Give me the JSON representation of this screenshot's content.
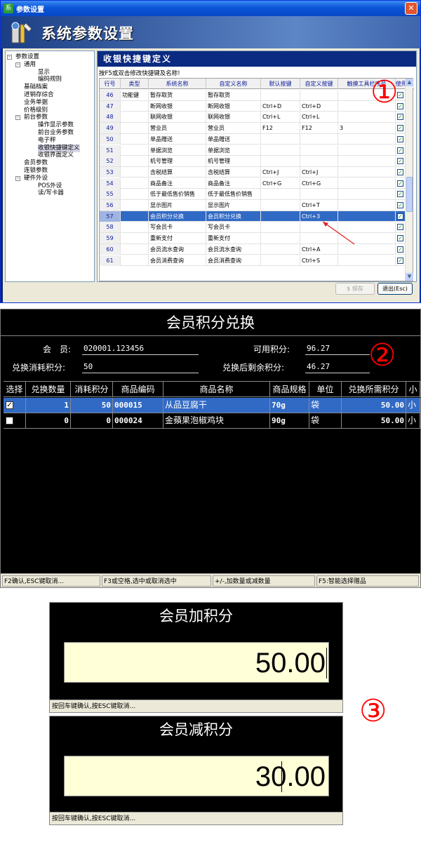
{
  "panel1": {
    "window_title": "参数设置",
    "app_icon": "系",
    "banner_title": "系统参数设置",
    "tree": [
      {
        "label": "参数设置",
        "level": 0,
        "expander": "-"
      },
      {
        "label": "通用",
        "level": 1,
        "expander": "-"
      },
      {
        "label": "显示",
        "level": 2,
        "expander": ""
      },
      {
        "label": "编码规则",
        "level": 2,
        "expander": ""
      },
      {
        "label": "基础档案",
        "level": 1,
        "expander": ""
      },
      {
        "label": "进销存综合",
        "level": 1,
        "expander": ""
      },
      {
        "label": "业务单据",
        "level": 1,
        "expander": ""
      },
      {
        "label": "价格级别",
        "level": 1,
        "expander": ""
      },
      {
        "label": "前台参数",
        "level": 1,
        "expander": "-"
      },
      {
        "label": "操作显示参数",
        "level": 2,
        "expander": ""
      },
      {
        "label": "前台业务参数",
        "level": 2,
        "expander": ""
      },
      {
        "label": "电子秤",
        "level": 2,
        "expander": ""
      },
      {
        "label": "收银快捷键定义",
        "level": 2,
        "expander": "",
        "selected": true
      },
      {
        "label": "收银界面定义",
        "level": 2,
        "expander": ""
      },
      {
        "label": "会员参数",
        "level": 1,
        "expander": ""
      },
      {
        "label": "连锁参数",
        "level": 1,
        "expander": ""
      },
      {
        "label": "硬件外设",
        "level": 1,
        "expander": "-"
      },
      {
        "label": "POS外设",
        "level": 2,
        "expander": ""
      },
      {
        "label": "读/写卡器",
        "level": 2,
        "expander": ""
      }
    ],
    "section_title": "收银快捷键定义",
    "hint": "按F5或双击修改快捷键及名称!",
    "columns": [
      "行号",
      "类型",
      "系统名称",
      "自定义名称",
      "默认按键",
      "自定义按键",
      "触摸工具栏序号",
      "使用"
    ],
    "rows": [
      {
        "no": "46",
        "type": "功能键",
        "sys": "暂存取货",
        "custom": "暂存取货",
        "def_key": "",
        "cust_key": "",
        "touch": "",
        "use": "✓"
      },
      {
        "no": "47",
        "type": "",
        "sys": "断网收银",
        "custom": "断网收银",
        "def_key": "Ctrl+D",
        "cust_key": "Ctrl+D",
        "touch": "",
        "use": "✓"
      },
      {
        "no": "48",
        "type": "",
        "sys": "联网收银",
        "custom": "联网收银",
        "def_key": "Ctrl+L",
        "cust_key": "Ctrl+L",
        "touch": "",
        "use": "✓"
      },
      {
        "no": "49",
        "type": "",
        "sys": "营业员",
        "custom": "营业员",
        "def_key": "F12",
        "cust_key": "F12",
        "touch": "3",
        "use": "✓"
      },
      {
        "no": "50",
        "type": "",
        "sys": "单品赠送",
        "custom": "单品赠送",
        "def_key": "",
        "cust_key": "",
        "touch": "",
        "use": "✓"
      },
      {
        "no": "51",
        "type": "",
        "sys": "单据浏览",
        "custom": "单据浏览",
        "def_key": "",
        "cust_key": "",
        "touch": "",
        "use": "✓"
      },
      {
        "no": "52",
        "type": "",
        "sys": "机号管理",
        "custom": "机号管理",
        "def_key": "",
        "cust_key": "",
        "touch": "",
        "use": "✓"
      },
      {
        "no": "53",
        "type": "",
        "sys": "含税结算",
        "custom": "含税结算",
        "def_key": "Ctrl+J",
        "cust_key": "Ctrl+J",
        "touch": "",
        "use": "✓"
      },
      {
        "no": "54",
        "type": "",
        "sys": "商品备注",
        "custom": "商品备注",
        "def_key": "Ctrl+G",
        "cust_key": "Ctrl+G",
        "touch": "",
        "use": "✓"
      },
      {
        "no": "55",
        "type": "",
        "sys": "低于最低售价销售",
        "custom": "低于最低售价销售",
        "def_key": "",
        "cust_key": "",
        "touch": "",
        "use": "✓"
      },
      {
        "no": "56",
        "type": "",
        "sys": "显示图片",
        "custom": "显示图片",
        "def_key": "",
        "cust_key": "Ctrl+T",
        "touch": "",
        "use": "✓"
      },
      {
        "no": "57",
        "type": "",
        "sys": "会员积分兑换",
        "custom": "会员积分兑换",
        "def_key": "",
        "cust_key": "Ctrl+3",
        "touch": "",
        "use": "✓",
        "selected": true
      },
      {
        "no": "58",
        "type": "",
        "sys": "写会员卡",
        "custom": "写会员卡",
        "def_key": "",
        "cust_key": "",
        "touch": "",
        "use": "✓"
      },
      {
        "no": "59",
        "type": "",
        "sys": "重新支付",
        "custom": "重新支付",
        "def_key": "",
        "cust_key": "",
        "touch": "",
        "use": "✓"
      },
      {
        "no": "60",
        "type": "",
        "sys": "会员流水查询",
        "custom": "会员流水查询",
        "def_key": "",
        "cust_key": "Ctrl+A",
        "touch": "",
        "use": "✓"
      },
      {
        "no": "61",
        "type": "",
        "sys": "会员消费查询",
        "custom": "会员消费查询",
        "def_key": "",
        "cust_key": "Ctrl+S",
        "touch": "",
        "use": "✓"
      }
    ],
    "save_label": "保存",
    "exit_label": "退出(Esc)",
    "callout": "①"
  },
  "panel2": {
    "title": "会员积分兑换",
    "member_label": "会　员:",
    "member_value": "020001.123456",
    "avail_label": "可用积分:",
    "avail_value": "96.27",
    "consume_label": "兑换消耗积分:",
    "consume_value": "50",
    "remain_label": "兑换后剩余积分:",
    "remain_value": "46.27",
    "callout": "②",
    "columns": [
      "选择",
      "兑换数量",
      "消耗积分",
      "商品编码",
      "商品名称",
      "商品规格",
      "单位",
      "兑换所需积分",
      "小"
    ],
    "rows": [
      {
        "checked": "✓",
        "qty": "1",
        "points": "50",
        "code": "000015",
        "name": "从品豆腐干",
        "spec": "70g",
        "unit": "袋",
        "need": "50.00",
        "extra": "小",
        "selected": true
      },
      {
        "checked": "",
        "qty": "0",
        "points": "0",
        "code": "000024",
        "name": "金蘋果泡椒鸡块",
        "spec": "90g",
        "unit": "袋",
        "need": "50.00",
        "extra": "小",
        "selected": false
      }
    ],
    "status": [
      "F2确认,ESC键取消...",
      "F3或空格,选中或取消选中",
      "+/-,加数量或减数量",
      "F5:智能选择赠品"
    ]
  },
  "panel3": {
    "callout": "③",
    "add": {
      "title": "会员加积分",
      "value": "50.00",
      "status": "按回车键确认,按ESC键取消..."
    },
    "sub": {
      "title": "会员减积分",
      "value": "30.00",
      "status": "按回车键确认,按ESC键取消..."
    }
  }
}
